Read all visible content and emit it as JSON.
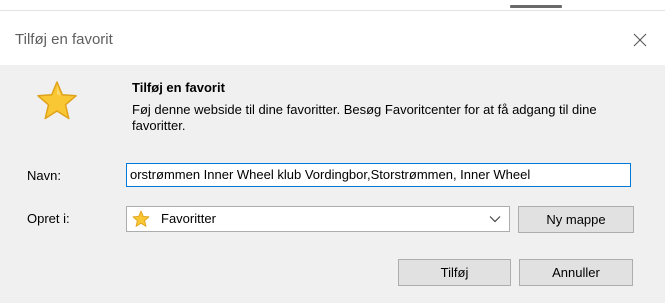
{
  "window": {
    "title": "Tilføj en favorit"
  },
  "dialog": {
    "heading": "Tilføj en favorit",
    "description": "Føj denne webside til dine favoritter. Besøg Favoritcenter for at få adgang til dine favoritter."
  },
  "name_field": {
    "label": "Navn:",
    "value": "orstrømmen Inner Wheel klub Vordingbor,Storstrømmen, Inner Wheel"
  },
  "create_in": {
    "label": "Opret i:",
    "selected": "Favoritter"
  },
  "buttons": {
    "new_folder": "Ny mappe",
    "add": "Tilføj",
    "cancel": "Annuller"
  },
  "icons": {
    "close": "close-icon",
    "favorite_star": "star-icon",
    "folder_star": "star-icon",
    "dropdown": "chevron-down-icon"
  },
  "colors": {
    "star_fill": "#f9c734",
    "star_stroke": "#e0a21b",
    "input_focus_border": "#0078d7",
    "dialog_background": "#f0f0f0",
    "button_background": "#e1e1e1"
  }
}
